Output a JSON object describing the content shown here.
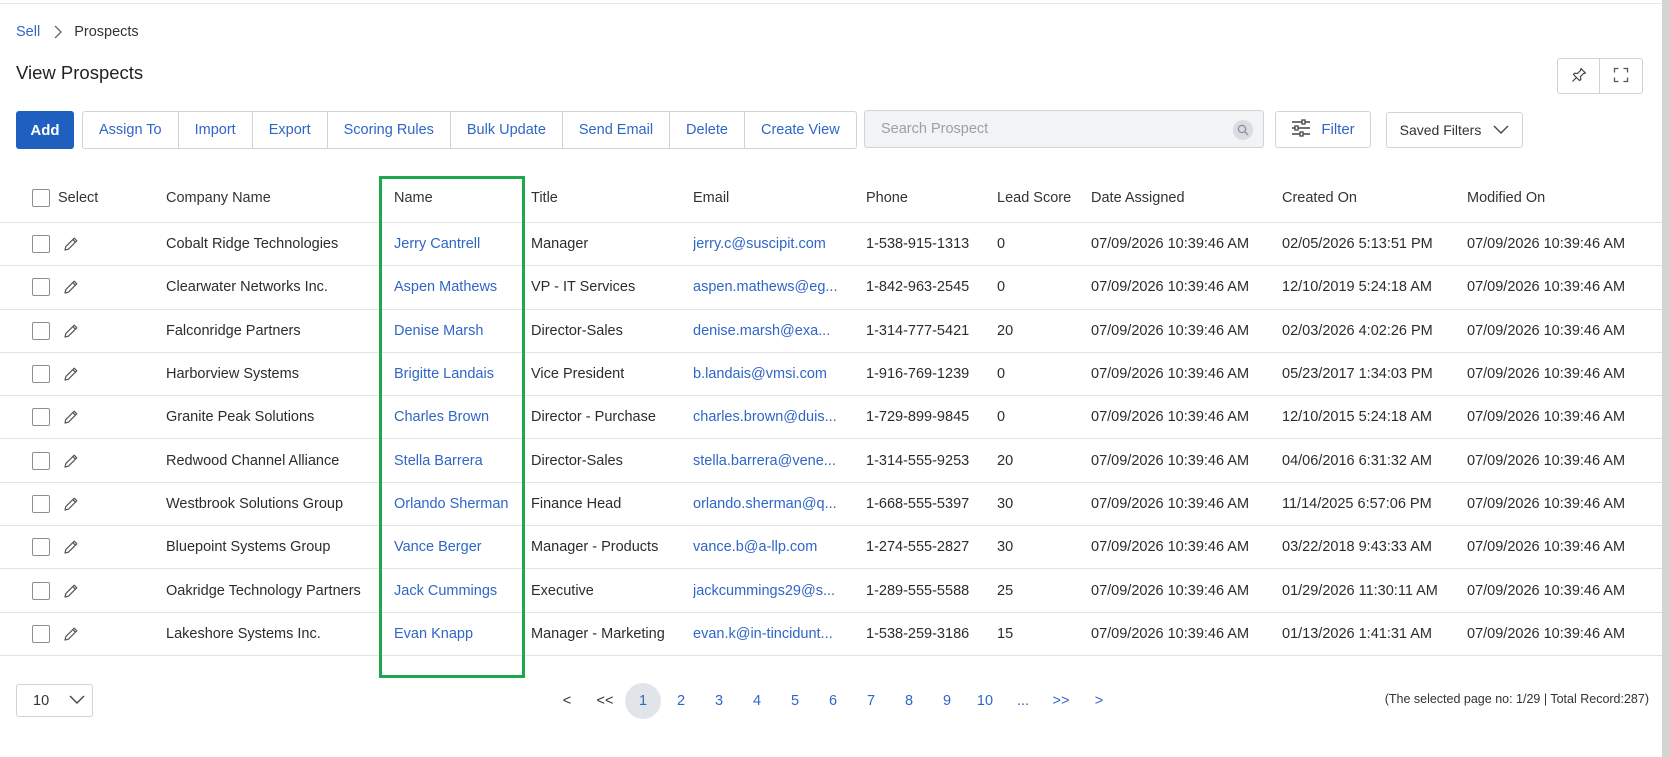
{
  "breadcrumb": {
    "root": "Sell",
    "current": "Prospects"
  },
  "page_title": "View Prospects",
  "toolbar": {
    "add_label": "Add",
    "buttons": [
      "Assign To",
      "Import",
      "Export",
      "Scoring Rules",
      "Bulk Update",
      "Send Email",
      "Delete",
      "Create View"
    ]
  },
  "search": {
    "placeholder": "Search Prospect",
    "value": ""
  },
  "filter": {
    "label": "Filter"
  },
  "saved_filters": {
    "label": "Saved Filters"
  },
  "table": {
    "headers": {
      "select": "Select",
      "company": "Company Name",
      "name": "Name",
      "title": "Title",
      "email": "Email",
      "phone": "Phone",
      "score": "Lead Score",
      "assigned": "Date Assigned",
      "created": "Created On",
      "modified": "Modified On"
    },
    "rows": [
      {
        "company": "Cobalt Ridge Technologies",
        "name": "Jerry Cantrell",
        "title": "Manager",
        "email": "jerry.c@suscipit.com",
        "phone": "1-538-915-1313",
        "score": "0",
        "assigned": "07/09/2026 10:39:46 AM",
        "created": "02/05/2026 5:13:51 PM",
        "modified": "07/09/2026 10:39:46 AM"
      },
      {
        "company": "Clearwater Networks Inc.",
        "name": "Aspen Mathews",
        "title": "VP - IT Services",
        "email": "aspen.mathews@eg...",
        "phone": "1-842-963-2545",
        "score": "0",
        "assigned": "07/09/2026 10:39:46 AM",
        "created": "12/10/2019 5:24:18 AM",
        "modified": "07/09/2026 10:39:46 AM"
      },
      {
        "company": "Falconridge Partners",
        "name": "Denise Marsh",
        "title": "Director-Sales",
        "email": "denise.marsh@exa...",
        "phone": "1-314-777-5421",
        "score": "20",
        "assigned": "07/09/2026 10:39:46 AM",
        "created": "02/03/2026 4:02:26 PM",
        "modified": "07/09/2026 10:39:46 AM"
      },
      {
        "company": "Harborview Systems",
        "name": "Brigitte Landais",
        "title": "Vice President",
        "email": "b.landais@vmsi.com",
        "phone": "1-916-769-1239",
        "score": "0",
        "assigned": "07/09/2026 10:39:46 AM",
        "created": "05/23/2017 1:34:03 PM",
        "modified": "07/09/2026 10:39:46 AM"
      },
      {
        "company": "Granite Peak Solutions",
        "name": "Charles Brown",
        "title": "Director - Purchase",
        "email": "charles.brown@duis...",
        "phone": "1-729-899-9845",
        "score": "0",
        "assigned": "07/09/2026 10:39:46 AM",
        "created": "12/10/2015 5:24:18 AM",
        "modified": "07/09/2026 10:39:46 AM"
      },
      {
        "company": "Redwood Channel Alliance",
        "name": "Stella Barrera",
        "title": "Director-Sales",
        "email": "stella.barrera@vene...",
        "phone": "1-314-555-9253",
        "score": "20",
        "assigned": "07/09/2026 10:39:46 AM",
        "created": "04/06/2016 6:31:32 AM",
        "modified": "07/09/2026 10:39:46 AM"
      },
      {
        "company": "Westbrook Solutions Group",
        "name": "Orlando Sherman",
        "title": "Finance Head",
        "email": "orlando.sherman@q...",
        "phone": "1-668-555-5397",
        "score": "30",
        "assigned": "07/09/2026 10:39:46 AM",
        "created": "11/14/2025 6:57:06 PM",
        "modified": "07/09/2026 10:39:46 AM"
      },
      {
        "company": "Bluepoint Systems Group",
        "name": "Vance Berger",
        "title": "Manager - Products",
        "email": "vance.b@a-llp.com",
        "phone": "1-274-555-2827",
        "score": "30",
        "assigned": "07/09/2026 10:39:46 AM",
        "created": "03/22/2018 9:43:33 AM",
        "modified": "07/09/2026 10:39:46 AM"
      },
      {
        "company": "Oakridge Technology Partners",
        "name": "Jack Cummings",
        "title": "Executive",
        "email": "jackcummings29@s...",
        "phone": "1-289-555-5588",
        "score": "25",
        "assigned": "07/09/2026 10:39:46 AM",
        "created": "01/29/2026 11:30:11 AM",
        "modified": "07/09/2026 10:39:46 AM"
      },
      {
        "company": "Lakeshore Systems Inc.",
        "name": "Evan Knapp",
        "title": "Manager - Marketing",
        "email": "evan.k@in-tincidunt...",
        "phone": "1-538-259-3186",
        "score": "15",
        "assigned": "07/09/2026 10:39:46 AM",
        "created": "01/13/2026 1:41:31 AM",
        "modified": "07/09/2026 10:39:46 AM"
      }
    ]
  },
  "pagination": {
    "page_size": "10",
    "items": [
      "<",
      "<<",
      "1",
      "2",
      "3",
      "4",
      "5",
      "6",
      "7",
      "8",
      "9",
      "10",
      "...",
      ">>",
      ">"
    ],
    "active": "1",
    "status": "(The selected page no: 1/29 | Total Record:287)"
  },
  "colors": {
    "accent": "#1f5fbf",
    "link": "#2f66c7",
    "highlight_box": "#1ea84b"
  }
}
